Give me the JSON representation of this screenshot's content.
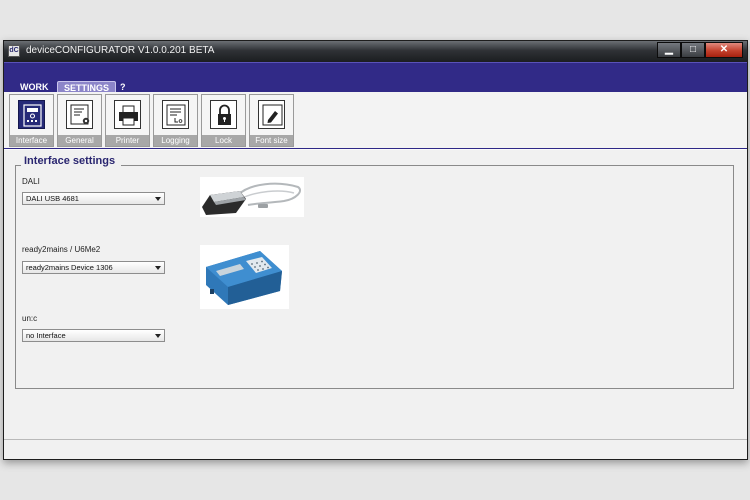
{
  "window": {
    "title": "deviceCONFIGURATOR V1.0.0.201 BETA",
    "app_icon_text": "dC",
    "controls": {
      "minimize": "▁",
      "maximize": "□",
      "close": "✕"
    }
  },
  "menu": {
    "tabs": [
      {
        "label": "WORK",
        "active": false
      },
      {
        "label": "SETTINGS",
        "active": true
      },
      {
        "label": "?",
        "active": false
      }
    ]
  },
  "toolbar": {
    "items": [
      {
        "label": "Interface",
        "icon": "interface-icon"
      },
      {
        "label": "General",
        "icon": "general-settings-icon"
      },
      {
        "label": "Printer",
        "icon": "printer-icon"
      },
      {
        "label": "Logging",
        "icon": "log-icon"
      },
      {
        "label": "Lock",
        "icon": "lock-icon"
      },
      {
        "label": "Font size",
        "icon": "pencil-icon"
      }
    ]
  },
  "interface_settings": {
    "title": "Interface settings",
    "groups": [
      {
        "label": "DALI",
        "selected": "DALI USB 4681",
        "image": "dali-usb-interface-photo"
      },
      {
        "label": "ready2mains / U6Me2",
        "selected": "ready2mains Device 1306",
        "image": "ready2mains-device-photo"
      },
      {
        "label": "un:c",
        "selected": "no Interface"
      }
    ]
  },
  "colors": {
    "menubar": "#312a87",
    "accent_text": "#2a2670",
    "tab_active": "#8c85c9"
  }
}
